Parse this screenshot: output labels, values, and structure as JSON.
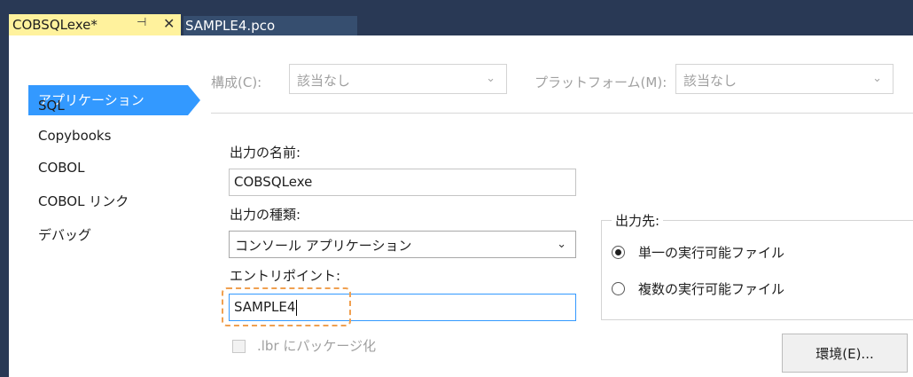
{
  "tabs": {
    "active": {
      "label": "COBSQLexe*",
      "pin_glyph": "⊣",
      "close_glyph": "✕"
    },
    "inactive": {
      "label": "SAMPLE4.pco"
    }
  },
  "sidebar": {
    "items": [
      {
        "label": "アプリケーション",
        "selected": true
      },
      {
        "label": "SQL"
      },
      {
        "label": "Copybooks"
      },
      {
        "label": "COBOL"
      },
      {
        "label": "COBOL リンク"
      },
      {
        "label": "デバッグ"
      }
    ]
  },
  "config": {
    "configuration_label": "構成(C):",
    "configuration_value": "該当なし",
    "platform_label": "プラットフォーム(M):",
    "platform_value": "該当なし"
  },
  "form": {
    "output_name_label": "出力の名前:",
    "output_name_value": "COBSQLexe",
    "output_type_label": "出力の種類:",
    "output_type_value": "コンソール アプリケーション",
    "entry_point_label": "エントリポイント:",
    "entry_point_value": "SAMPLE4",
    "package_label": ".lbr にパッケージ化",
    "package_checked": false
  },
  "output_target": {
    "title": "出力先:",
    "options": [
      {
        "label": "単一の実行可能ファイル",
        "checked": true
      },
      {
        "label": "複数の実行可能ファイル",
        "checked": false
      }
    ]
  },
  "buttons": {
    "environment_label": "環境(E)..."
  },
  "colors": {
    "title_bar": "#293955",
    "active_tab": "#fff29d",
    "selection": "#3399ff",
    "highlight": "#f0a050"
  }
}
